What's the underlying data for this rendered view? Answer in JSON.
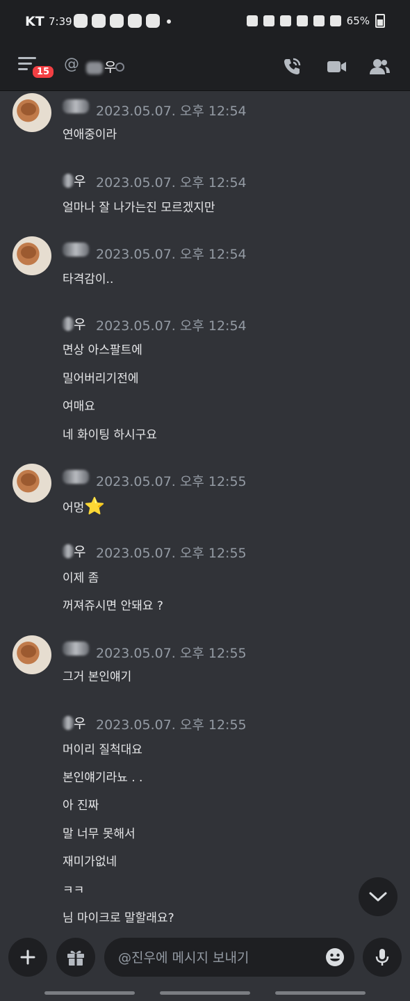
{
  "statusbar": {
    "carrier": "KT",
    "time": "7:39",
    "battery": "65%"
  },
  "header": {
    "badge_count": "15",
    "at": "@",
    "channel_name_suffix": "우"
  },
  "groups": [
    {
      "author_suffix": "",
      "timestamp": "2023.05.07. 오후 12:54",
      "lines": [
        "연애중이라"
      ]
    },
    {
      "author_suffix": "우",
      "timestamp": "2023.05.07. 오후 12:54",
      "lines": [
        "얼마나 잘 나가는진 모르겠지만"
      ]
    },
    {
      "author_suffix": "",
      "timestamp": "2023.05.07. 오후 12:54",
      "lines": [
        "타격감이.."
      ]
    },
    {
      "author_suffix": "우",
      "timestamp": "2023.05.07. 오후 12:54",
      "lines": [
        "면상 아스팔트에",
        "밀어버리기전에",
        "여매요",
        "네 화이팅 하시구요"
      ]
    },
    {
      "author_suffix": "",
      "timestamp": "2023.05.07. 오후 12:55",
      "lines": [
        "어멍"
      ],
      "emoji": "⭐"
    },
    {
      "author_suffix": "우",
      "timestamp": "2023.05.07. 오후 12:55",
      "lines": [
        "이제 좀",
        "꺼져쥬시면 안돼요 ?"
      ]
    },
    {
      "author_suffix": "",
      "timestamp": "2023.05.07. 오후 12:55",
      "lines": [
        "그거 본인얘기"
      ]
    },
    {
      "author_suffix": "우",
      "timestamp": "2023.05.07. 오후 12:55",
      "lines": [
        "머이리 질척대요",
        "본인얘기라뇨 . .",
        "아 진짜",
        "말 너무 못해서",
        "재미가없네",
        "ㅋㅋ",
        "님 마이크로 말할래요?"
      ]
    }
  ],
  "composer": {
    "placeholder": "@진우에 메시지 보내기"
  }
}
